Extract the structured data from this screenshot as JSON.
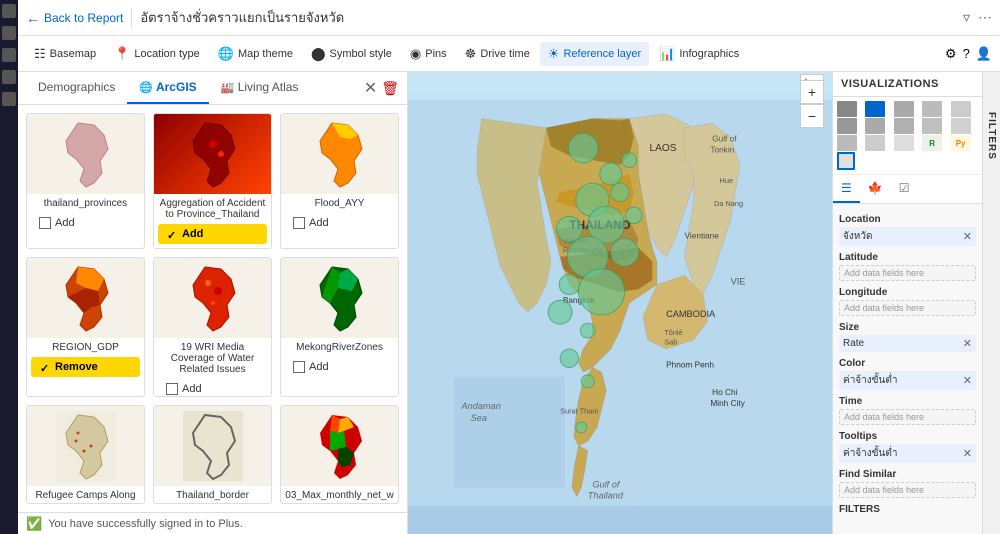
{
  "app": {
    "title": "อัตราจ้างชั่วคราวแยกเป็นรายจังหวัด",
    "back_label": "Back to Report"
  },
  "toolbar": {
    "basemap_label": "Basemap",
    "location_type_label": "Location type",
    "map_theme_label": "Map theme",
    "symbol_style_label": "Symbol style",
    "pins_label": "Pins",
    "drive_time_label": "Drive time",
    "reference_label": "Reference layer",
    "infographics_label": "Infographics"
  },
  "panel": {
    "tabs": [
      {
        "id": "demographics",
        "label": "Demographics",
        "active": false
      },
      {
        "id": "arcgis",
        "label": "ArcGIS",
        "active": true
      },
      {
        "id": "living_atlas",
        "label": "Living Atlas",
        "active": false
      }
    ],
    "layers": [
      {
        "id": "thailand_provinces",
        "title": "thailand_provinces",
        "thumbnail_type": "pink",
        "has_add": true,
        "add_label": "Add",
        "added": false
      },
      {
        "id": "aggregation",
        "title": "Aggregation of Accident to Province_Thailand",
        "thumbnail_type": "red",
        "has_add": true,
        "add_label": "Add",
        "added": true
      },
      {
        "id": "flood",
        "title": "Flood_AYY",
        "thumbnail_type": "flood",
        "has_add": true,
        "add_label": "Add",
        "added": false
      },
      {
        "id": "region_gdp",
        "title": "REGION_GDP",
        "thumbnail_type": "region",
        "has_add": true,
        "add_label": "Remove",
        "remove": true,
        "added": true
      },
      {
        "id": "wri",
        "title": "19 WRI Media Coverage of Water Related Issues",
        "thumbnail_type": "wri",
        "has_add": true,
        "add_label": "Add",
        "added": false
      },
      {
        "id": "mekong",
        "title": "MekongRiverZones",
        "thumbnail_type": "mekong",
        "has_add": true,
        "add_label": "Add",
        "added": false
      },
      {
        "id": "refugee",
        "title": "Refugee Camps Along",
        "thumbnail_type": "refugee",
        "has_add": false
      },
      {
        "id": "thailand_border",
        "title": "Thailand_border",
        "thumbnail_type": "border",
        "has_add": false
      },
      {
        "id": "03max",
        "title": "03_Max_monthly_net_w",
        "thumbnail_type": "max",
        "has_add": false
      }
    ]
  },
  "visualizations": {
    "header": "VISUALIZATIONS",
    "fields": {
      "location_label": "Location",
      "location_value": "จังหวัด",
      "latitude_label": "Latitude",
      "latitude_placeholder": "Add data fields here",
      "longitude_label": "Longitude",
      "longitude_placeholder": "Add data fields here",
      "size_label": "Size",
      "size_value": "Rate",
      "color_label": "Color",
      "color_value": "ค่าจ้างขั้นต่ำ",
      "time_label": "Time",
      "time_placeholder": "Add data fields here",
      "tooltips_label": "Tooltips",
      "tooltips_value": "ค่าจ้างขั้นต่ำ",
      "find_similar_label": "Find Similar",
      "find_similar_placeholder": "Add data fields here"
    }
  },
  "filters": {
    "header": "FILTERS"
  },
  "status": {
    "message": "You have successfully signed in to Plus."
  },
  "map": {
    "labels": [
      "LAOS",
      "Gulf of Tonkin",
      "Vientiane",
      "THAILAND",
      "Nakhon Ratchasima",
      "CAMBODIA",
      "Tônlé Sab",
      "Phnom Penh",
      "Ho Chi Minh City",
      "VIE",
      "Gulf of Thailand",
      "Andaman Sea",
      "Bangkok",
      "Surat Thani",
      "Da Nang",
      "Hue"
    ]
  }
}
